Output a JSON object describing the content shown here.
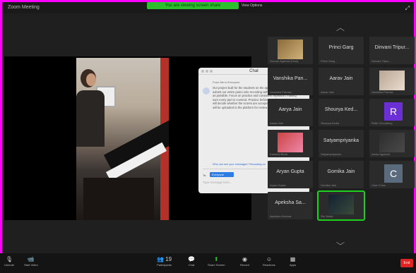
{
  "topbar": {
    "left_label": "Zoom Meeting",
    "share_banner": "You are viewing screen share",
    "share_stop": "View Options",
    "right_icon": "fullscreen-icon"
  },
  "chat": {
    "title": "Chat",
    "sender": "From Me to Everyone",
    "time": "11:07 AM",
    "body": "Our project built for the students on the app. We have been asked to submit our entire piano solo recording with as much effort put into it as possible. Focus on practice and consistent repetition, making sure every part is covered. Practice before you play, the instructor will decide whether the scores are acceptable, and the performance will be uploaded to the platform for review.",
    "note": "Who can see your messages? Recording on",
    "to_label": "To:",
    "to_value": "Everyone",
    "input_placeholder": "Type message here..."
  },
  "participants": [
    {
      "name": "",
      "sub": "Gourav Agarwal (Host)",
      "type": "video"
    },
    {
      "name": "Princi Garg",
      "sub": "Princi Garg",
      "type": "name"
    },
    {
      "name": "Dinvani Tripur...",
      "sub": "Dinvani Tripur...",
      "type": "name"
    },
    {
      "name": "Vanshika Pan...",
      "sub": "Vanshika Pandey",
      "type": "name"
    },
    {
      "name": "Aarav Jain",
      "sub": "Aarav Jain",
      "type": "name"
    },
    {
      "name": "",
      "sub": "Vanshika Panwar",
      "type": "video"
    },
    {
      "name": "Aarya Jain",
      "sub": "Aarya Jain",
      "type": "name"
    },
    {
      "name": "Shourya Ked...",
      "sub": "Shourya Kedia",
      "type": "name"
    },
    {
      "name": "",
      "sub": "Ridhi Choudhary",
      "type": "letter",
      "letter": "R"
    },
    {
      "name": "",
      "sub": "Kaushal Bhatt",
      "type": "video"
    },
    {
      "name": "Satyampriyanka",
      "sub": "Satyampriyanka",
      "type": "name"
    },
    {
      "name": "",
      "sub": "Arnav Agarwal",
      "type": "video"
    },
    {
      "name": "Aryan Gupta",
      "sub": "Aryan Gupta",
      "type": "name"
    },
    {
      "name": "Gomika Jain",
      "sub": "Gomika Jain",
      "type": "name"
    },
    {
      "name": "",
      "sub": "Chen Chen",
      "type": "letter",
      "letter": "C"
    },
    {
      "name": "Apeksha Sa...",
      "sub": "Apeksha Saxena",
      "type": "name"
    },
    {
      "name": "",
      "sub": "Sia Jindal",
      "type": "video"
    }
  ],
  "toolbar": {
    "unmute": "Unmute",
    "start_video": "Start Video",
    "participants": "Participants",
    "participants_count": "19",
    "chat": "Chat",
    "share_screen": "Share Screen",
    "record": "Record",
    "reactions": "Reactions",
    "apps": "Apps",
    "end": "End"
  },
  "colors": {
    "accent_green": "#2dbe2d",
    "end_red": "#e02424",
    "letter_r": "#6b2fd6",
    "letter_c": "#5b6b7e"
  }
}
